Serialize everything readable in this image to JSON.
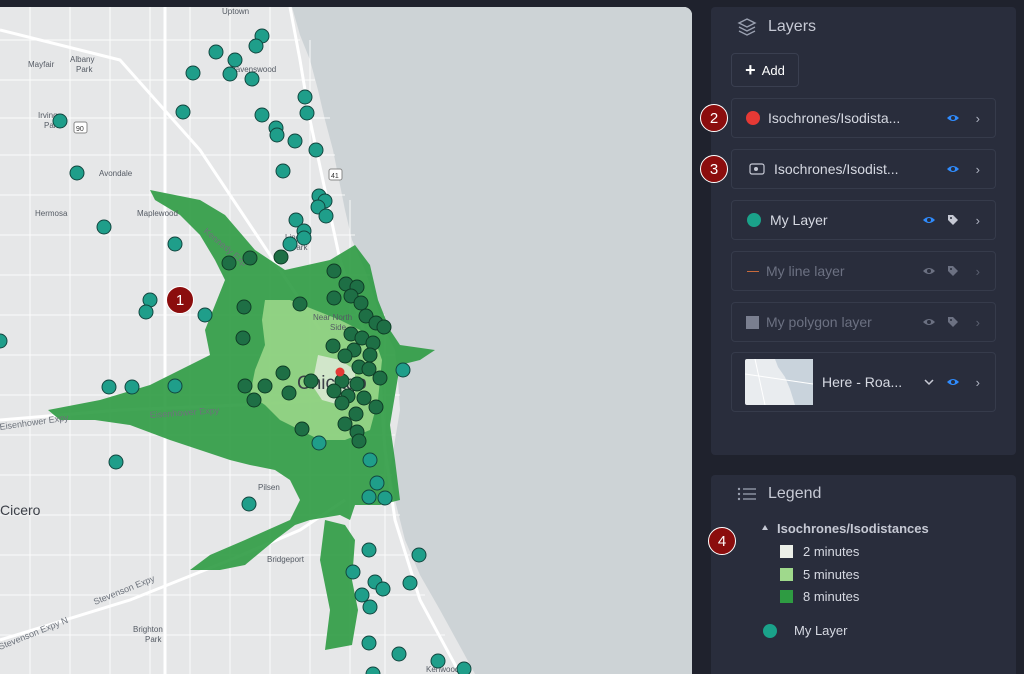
{
  "map": {
    "places": [
      "Uptown",
      "Albany",
      "Park",
      "Mayfair",
      "Ravenswood",
      "Irving",
      "Park",
      "Avondale",
      "Hermosa",
      "Maplewood",
      "Lincoln",
      "Park",
      "Near North",
      "Side",
      "Chicago",
      "Pilsen",
      "Bridgeport",
      "Brighton",
      "Park",
      "Cicero",
      "Kenwood"
    ],
    "roads": [
      "Kennedy Exp",
      "Eisenhower Expy",
      "Eisenhower Expy",
      "Stevenson Expy",
      "Stevenson Expy N"
    ],
    "shields": [
      "90",
      "41"
    ]
  },
  "layers": {
    "title": "Layers",
    "add_label": "Add",
    "items": [
      {
        "name": "Isochrones/Isodista...",
        "color": "#e53935",
        "icon": "point-icon",
        "visible": true
      },
      {
        "name": "Isochrones/Isodist...",
        "color": "#c6c9d4",
        "icon": "route-icon",
        "visible": true
      },
      {
        "name": "My Layer",
        "color": "#1aa28a",
        "icon": "point-icon",
        "visible": true
      },
      {
        "name": "My line layer",
        "color": "#c86a3c",
        "icon": "line-icon",
        "visible": false
      },
      {
        "name": "My polygon layer",
        "color": "#7a7f90",
        "icon": "polygon-icon",
        "visible": false
      },
      {
        "name": "Here - Roa...",
        "icon": "basemap-thumbnail",
        "visible": true
      }
    ]
  },
  "legend": {
    "title": "Legend",
    "group_title": "Isochrones/Isodistances",
    "items": [
      {
        "label": "2 minutes",
        "color": "#ecefe8"
      },
      {
        "label": "5 minutes",
        "color": "#9fd98c"
      },
      {
        "label": "8 minutes",
        "color": "#2e9b42"
      }
    ],
    "layer_label": "My Layer",
    "layer_color": "#1aa28a"
  },
  "badges": [
    "1",
    "2",
    "3",
    "4"
  ]
}
